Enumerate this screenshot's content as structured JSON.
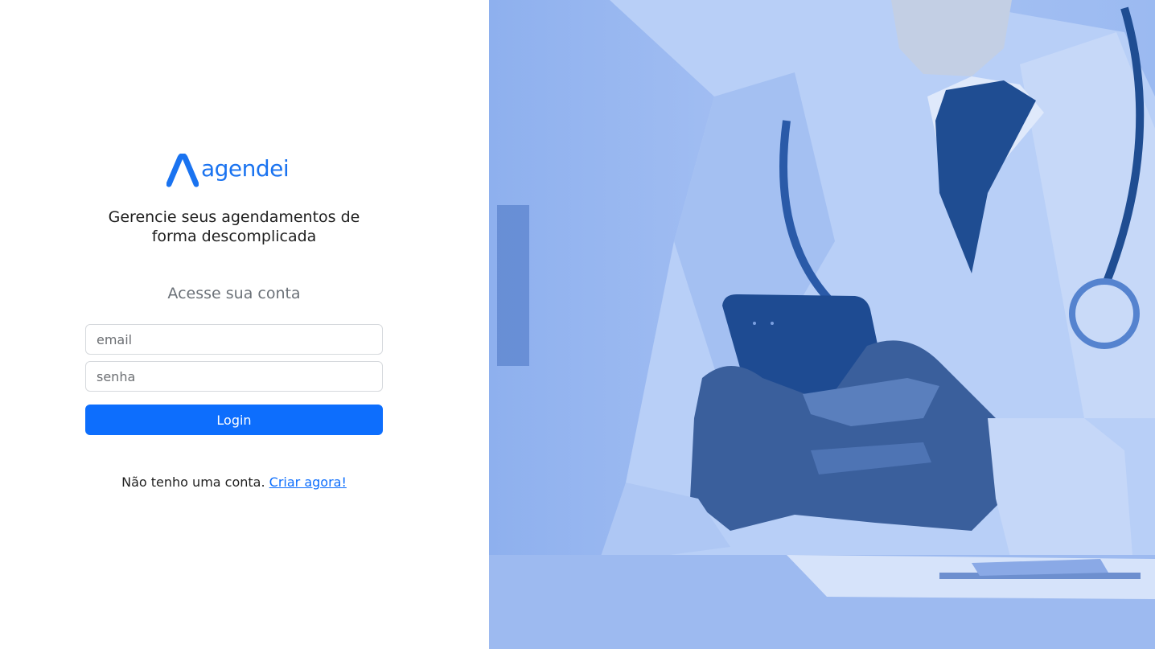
{
  "brand": {
    "name": "agendei",
    "color": "#1a73f0"
  },
  "tagline": {
    "line1": "Gerencie seus agendamentos de",
    "line2": "forma descomplicada"
  },
  "login_form": {
    "heading": "Acesse sua conta",
    "email_placeholder": "email",
    "password_placeholder": "senha",
    "submit_label": "Login",
    "button_color": "#0d6efd"
  },
  "signup": {
    "prompt": "Não tenho uma conta.",
    "link_label": "Criar agora!"
  },
  "hero_image": {
    "subject": "doctor-holding-phone-photo",
    "tint_color": "#6f9be8"
  }
}
